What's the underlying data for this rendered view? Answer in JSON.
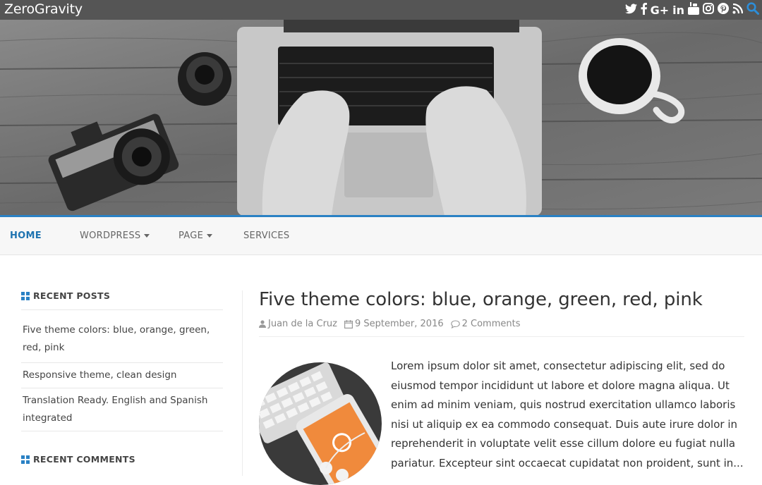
{
  "site": {
    "title": "ZeroGravity"
  },
  "social_icons": [
    {
      "name": "twitter-icon",
      "glyph": "🐦︎"
    },
    {
      "name": "facebook-icon",
      "glyph": "f"
    },
    {
      "name": "google-plus-icon",
      "glyph": "G+"
    },
    {
      "name": "linkedin-icon",
      "glyph": "in"
    },
    {
      "name": "youtube-icon",
      "glyph": "▣"
    },
    {
      "name": "instagram-icon",
      "glyph": "◎"
    },
    {
      "name": "pinterest-icon",
      "glyph": "℗"
    },
    {
      "name": "rss-icon",
      "glyph": "≋"
    },
    {
      "name": "search-icon",
      "glyph": "⌕"
    }
  ],
  "nav": {
    "home": "HOME",
    "wordpress": "WORDPRESS",
    "page": "PAGE",
    "services": "SERVICES"
  },
  "sidebar": {
    "recent_posts_title": "RECENT POSTS",
    "recent_posts": [
      "Five theme colors: blue, orange, green, red, pink",
      "Responsive theme, clean design",
      "Translation Ready. English and Spanish integrated"
    ],
    "recent_comments_title": "RECENT COMMENTS"
  },
  "post": {
    "title": "Five theme colors: blue, orange, green, red, pink",
    "author": "Juan de la Cruz",
    "date": "9 September, 2016",
    "comments": "2 Comments",
    "excerpt": "Lorem ipsum dolor sit amet, consectetur adipiscing elit, sed do eiusmod tempor incididunt ut labore et dolore magna aliqua. Ut enim ad minim veniam, quis nostrud exercitation ullamco laboris nisi ut aliquip ex ea commodo consequat. Duis aute irure dolor in reprehenderit in voluptate velit esse cillum dolore eu fugiat nulla pariatur. Excepteur sint occaecat cupidatat non proident, sunt in..."
  },
  "colors": {
    "topbar": "#555555",
    "accent": "#2a81c4",
    "nav_active": "#1e73b0"
  }
}
